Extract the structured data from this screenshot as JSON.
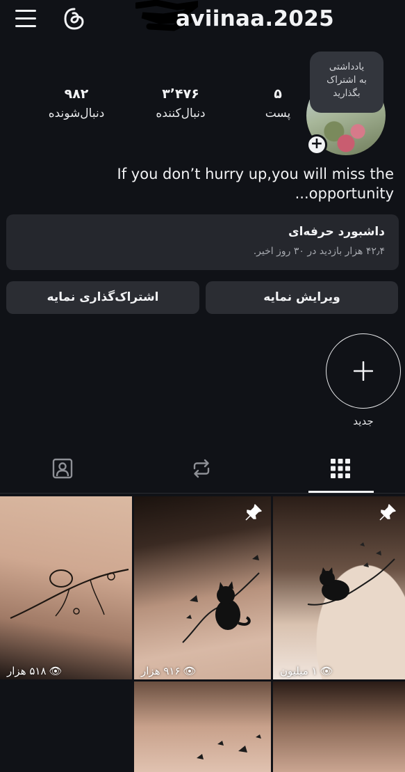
{
  "header": {
    "username": "aviinaa.2025",
    "menu_icon": "menu-icon",
    "threads_icon": "threads-icon"
  },
  "profile": {
    "note": [
      "یادداشتی",
      "به اشتراک",
      "بگذارید"
    ],
    "stats": {
      "posts": {
        "value": "۵",
        "label": "پست"
      },
      "followers": {
        "value": "۳٬۴۷۶",
        "label": "دنبال‌کننده"
      },
      "following": {
        "value": "۹۸۲",
        "label": "دنبال‌شونده"
      }
    },
    "bio_line1": "If you don’t hurry up,you will miss the",
    "bio_line2": "...opportunity"
  },
  "dashboard": {
    "title": "داشبورد حرفه‌ای",
    "subtitle": "۴۲٫۴ هزار بازدید در ۳۰ روز اخیر."
  },
  "buttons": {
    "edit_profile": "ویرایش نمایه",
    "share_profile": "اشتراک‌گذاری نمایه"
  },
  "highlight": {
    "new_label": "جدید"
  },
  "tabs": [
    "grid-icon",
    "reposts-icon",
    "tagged-icon"
  ],
  "posts": [
    {
      "views": "۱ میلیون",
      "pinned": true
    },
    {
      "views": "۹۱۶ هزار",
      "pinned": true
    },
    {
      "views": "۵۱۸ هزار",
      "pinned": false
    },
    {
      "views": "",
      "pinned": false
    },
    {
      "views": "",
      "pinned": false
    }
  ]
}
